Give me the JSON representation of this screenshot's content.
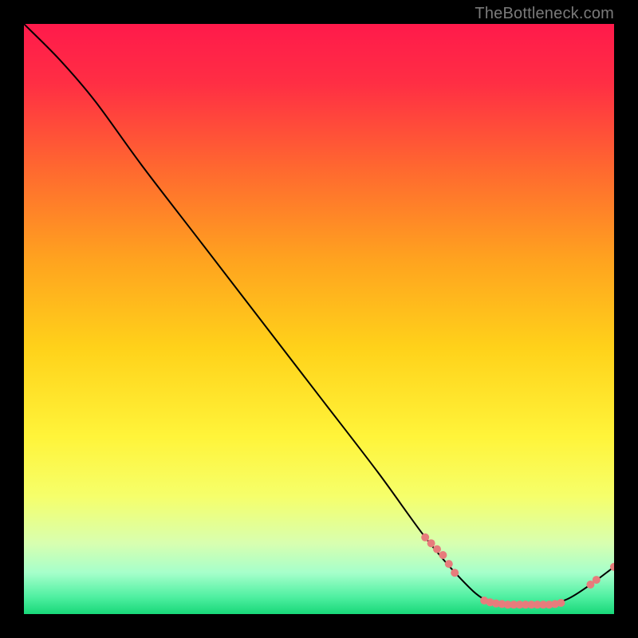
{
  "watermark": "TheBottleneck.com",
  "chart_data": {
    "type": "line",
    "title": "",
    "xlabel": "",
    "ylabel": "",
    "xlim": [
      0,
      100
    ],
    "ylim": [
      0,
      100
    ],
    "grid": false,
    "legend": false,
    "curve": [
      {
        "x": 0,
        "y": 100
      },
      {
        "x": 6,
        "y": 94
      },
      {
        "x": 12,
        "y": 87
      },
      {
        "x": 20,
        "y": 76
      },
      {
        "x": 30,
        "y": 63
      },
      {
        "x": 40,
        "y": 50
      },
      {
        "x": 50,
        "y": 37
      },
      {
        "x": 60,
        "y": 24
      },
      {
        "x": 68,
        "y": 13
      },
      {
        "x": 74,
        "y": 6
      },
      {
        "x": 78,
        "y": 2.5
      },
      {
        "x": 82,
        "y": 1.5
      },
      {
        "x": 88,
        "y": 1.5
      },
      {
        "x": 92,
        "y": 2.5
      },
      {
        "x": 96,
        "y": 5
      },
      {
        "x": 100,
        "y": 8
      }
    ],
    "points": [
      {
        "x": 68,
        "y": 13
      },
      {
        "x": 69,
        "y": 12
      },
      {
        "x": 70,
        "y": 11
      },
      {
        "x": 71,
        "y": 10
      },
      {
        "x": 72,
        "y": 8.5
      },
      {
        "x": 73,
        "y": 7
      },
      {
        "x": 78,
        "y": 2.3
      },
      {
        "x": 79,
        "y": 2.0
      },
      {
        "x": 80,
        "y": 1.8
      },
      {
        "x": 81,
        "y": 1.7
      },
      {
        "x": 82,
        "y": 1.6
      },
      {
        "x": 83,
        "y": 1.6
      },
      {
        "x": 84,
        "y": 1.6
      },
      {
        "x": 85,
        "y": 1.6
      },
      {
        "x": 86,
        "y": 1.6
      },
      {
        "x": 87,
        "y": 1.6
      },
      {
        "x": 88,
        "y": 1.6
      },
      {
        "x": 89,
        "y": 1.6
      },
      {
        "x": 90,
        "y": 1.7
      },
      {
        "x": 91,
        "y": 1.9
      },
      {
        "x": 96,
        "y": 5
      },
      {
        "x": 97,
        "y": 5.8
      },
      {
        "x": 100,
        "y": 8
      }
    ],
    "gradient_stops": [
      {
        "offset": 0.0,
        "color": "#ff1a4b"
      },
      {
        "offset": 0.1,
        "color": "#ff2e44"
      },
      {
        "offset": 0.25,
        "color": "#ff6a2f"
      },
      {
        "offset": 0.4,
        "color": "#ffa31f"
      },
      {
        "offset": 0.55,
        "color": "#ffd21a"
      },
      {
        "offset": 0.7,
        "color": "#fff43a"
      },
      {
        "offset": 0.8,
        "color": "#f6ff6a"
      },
      {
        "offset": 0.88,
        "color": "#d8ffb0"
      },
      {
        "offset": 0.93,
        "color": "#a6ffcb"
      },
      {
        "offset": 0.97,
        "color": "#51f0a2"
      },
      {
        "offset": 1.0,
        "color": "#18d879"
      }
    ],
    "curve_color": "#000000",
    "point_color": "#e77c7c",
    "point_radius": 5
  }
}
